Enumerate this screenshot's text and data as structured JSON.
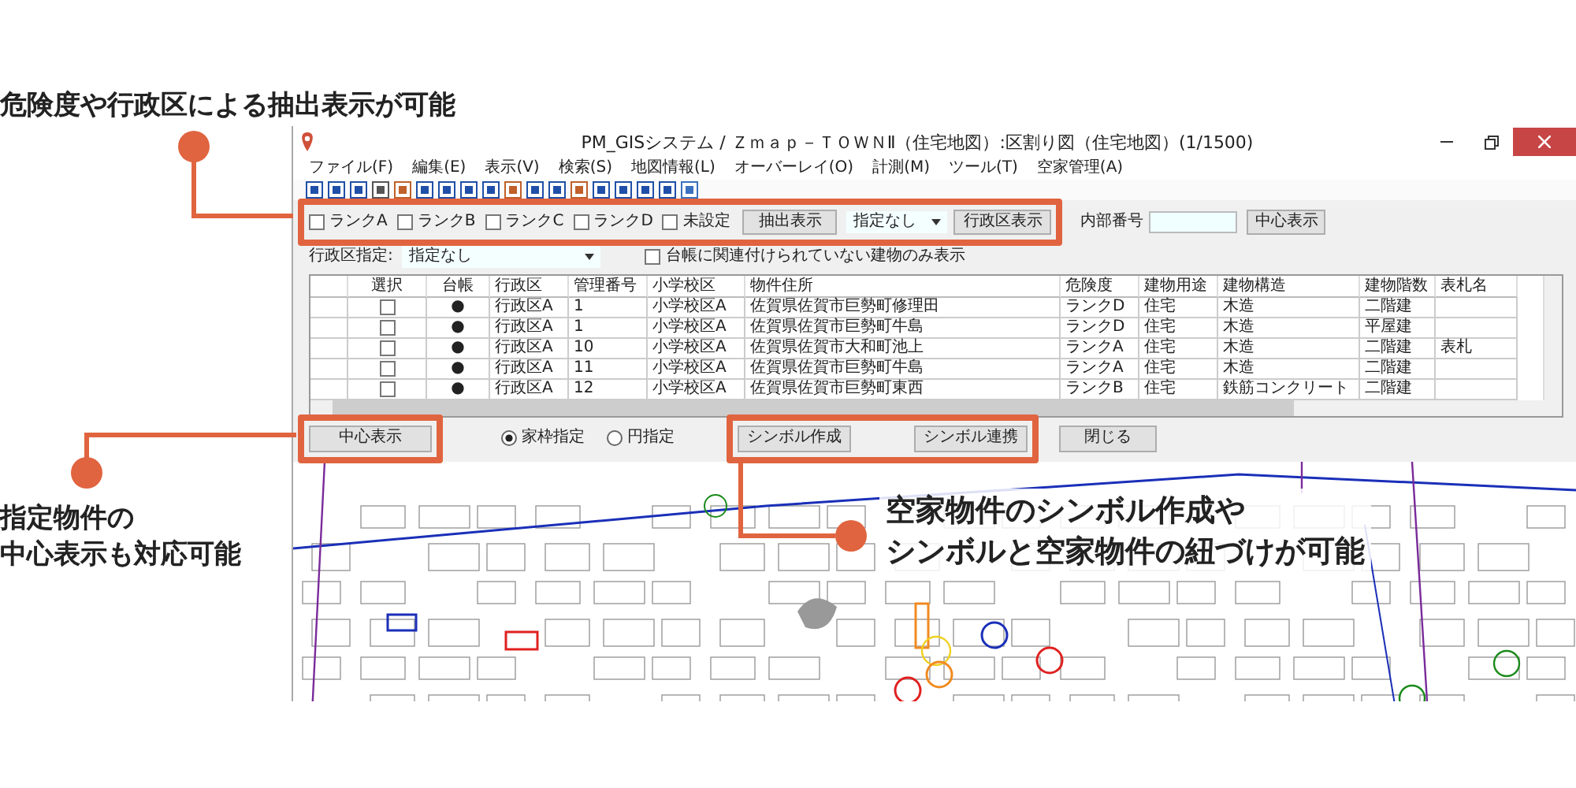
{
  "callouts": [
    {
      "lines": [
        "危険度や行政区による抽出表示が可能"
      ]
    },
    {
      "lines": [
        "指定物件の",
        "中心表示も対応可能"
      ]
    },
    {
      "lines": [
        "空家物件のシンボル作成や",
        "シンボルと空家物件の紐づけが可能"
      ]
    }
  ],
  "window": {
    "title": "PM_GISシステム / Ｚｍａｐ－ＴＯＷＮⅡ（住宅地図）:区割り図（住宅地図）(1/1500)"
  },
  "menu": [
    "ファイル(F)",
    "編集(E)",
    "表示(V)",
    "検索(S)",
    "地図情報(L)",
    "オーバーレイ(O)",
    "計測(M)",
    "ツール(T)",
    "空家管理(A)"
  ],
  "filter": {
    "ranks": [
      {
        "label": "ランクA",
        "checked": false
      },
      {
        "label": "ランクB",
        "checked": false
      },
      {
        "label": "ランクC",
        "checked": false
      },
      {
        "label": "ランクD",
        "checked": false
      },
      {
        "label": "未設定",
        "checked": false
      }
    ],
    "extract_button": "抽出表示",
    "district_select": "指定なし",
    "district_button": "行政区表示",
    "internal_number_label": "内部番号",
    "center_button": "中心表示"
  },
  "district_filter": {
    "label": "行政区指定:",
    "value": "指定なし",
    "unlinked_only": {
      "label": "台帳に関連付けられていない建物のみ表示",
      "checked": false
    }
  },
  "table": {
    "columns": [
      "選択",
      "台帳",
      "行政区",
      "管理番号",
      "小学校区",
      "物件住所",
      "危険度",
      "建物用途",
      "建物構造",
      "建物階数",
      "表札名"
    ],
    "rows": [
      {
        "checked": false,
        "ledger": "●",
        "district": "行政区A",
        "number": "1",
        "school": "小学校区A",
        "address": "佐賀県佐賀市巨勢町修理田",
        "risk": "ランクD",
        "use": "住宅",
        "structure": "木造",
        "floors": "二階建"
      },
      {
        "checked": false,
        "ledger": "●",
        "district": "行政区A",
        "number": "1",
        "school": "小学校区A",
        "address": "佐賀県佐賀市巨勢町牛島",
        "risk": "ランクD",
        "use": "住宅",
        "structure": "木造",
        "floors": "平屋建"
      },
      {
        "checked": false,
        "ledger": "●",
        "district": "行政区A",
        "number": "10",
        "school": "小学校区A",
        "address": "佐賀県佐賀市大和町池上",
        "risk": "ランクA",
        "use": "住宅",
        "structure": "木造",
        "floors": "二階建",
        "nameplate": "表札"
      },
      {
        "checked": false,
        "ledger": "●",
        "district": "行政区A",
        "number": "11",
        "school": "小学校区A",
        "address": "佐賀県佐賀市巨勢町牛島",
        "risk": "ランクA",
        "use": "住宅",
        "structure": "木造",
        "floors": "二階建"
      },
      {
        "checked": false,
        "ledger": "●",
        "district": "行政区A",
        "number": "12",
        "school": "小学校区A",
        "address": "佐賀県佐賀市巨勢町東西",
        "risk": "ランクB",
        "use": "住宅",
        "structure": "鉄筋コンクリート",
        "floors": "二階建"
      }
    ]
  },
  "bottom": {
    "center_button": "中心表示",
    "modes": [
      {
        "label": "家枠指定",
        "selected": true
      },
      {
        "label": "円指定",
        "selected": false
      }
    ],
    "buttons": [
      "シンボル作成",
      "シンボル連携",
      "閉じる"
    ]
  }
}
